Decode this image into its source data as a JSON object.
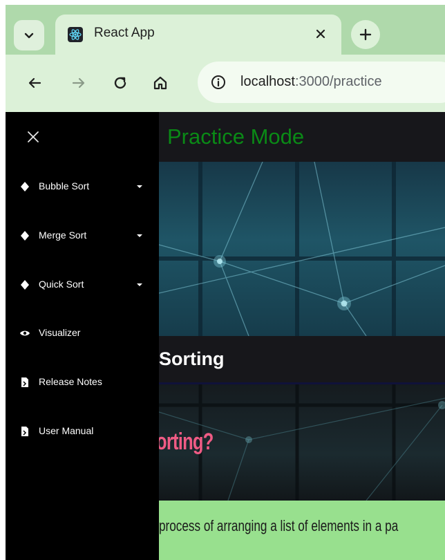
{
  "browser": {
    "tab_title": "React App",
    "url_host": "localhost",
    "url_rest": ":3000/practice",
    "icons": {
      "tab_search": "chevron-down-icon",
      "favicon": "react-icon",
      "close": "close-icon",
      "new_tab": "plus-icon",
      "back": "arrow-left-icon",
      "forward": "arrow-right-icon",
      "reload": "reload-icon",
      "home": "home-icon",
      "site_info": "info-icon"
    }
  },
  "sidebar": {
    "close_icon": "close-icon",
    "items": [
      {
        "label": "Bubble Sort",
        "icon": "diamond-icon",
        "has_caret": true
      },
      {
        "label": "Merge Sort",
        "icon": "diamond-icon",
        "has_caret": true
      },
      {
        "label": "Quick Sort",
        "icon": "diamond-icon",
        "has_caret": true
      },
      {
        "label": "Visualizer",
        "icon": "eye-icon",
        "has_caret": false
      },
      {
        "label": "Release Notes",
        "icon": "document-icon",
        "has_caret": false
      },
      {
        "label": "User Manual",
        "icon": "document-icon",
        "has_caret": false
      }
    ]
  },
  "main": {
    "title": "Practice Mode",
    "section_title": "Sorting",
    "banner_text": "orting?",
    "intro_text": "process of arranging a list of elements in a pa"
  },
  "colors": {
    "chrome_bg": "#afd9ab",
    "toolbar_bg": "#dcf1d8",
    "page_bg": "#17171b",
    "sidebar_bg": "#000000",
    "title_green": "#0a8a16",
    "banner_pink": "#ef5b84",
    "panel_green": "#98e08e"
  }
}
